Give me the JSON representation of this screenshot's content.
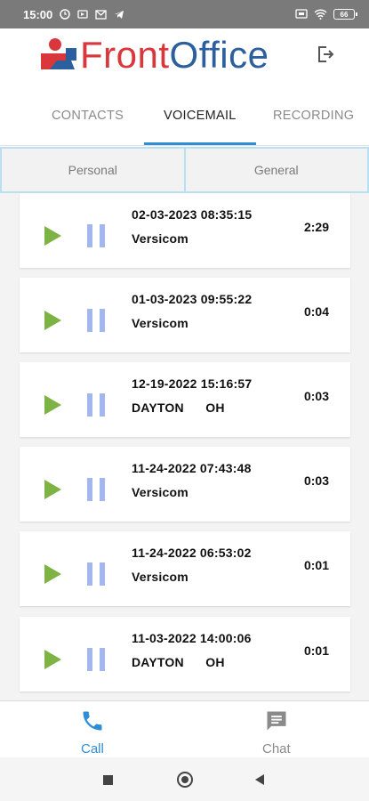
{
  "status_bar": {
    "time": "15:00",
    "battery": "66",
    "icons": [
      "alarm-icon",
      "media-icon",
      "mail-icon",
      "telegram-icon",
      "screen-icon",
      "wifi-icon",
      "battery-icon"
    ]
  },
  "header": {
    "logo_front": "Front",
    "logo_office": "Office",
    "logout_icon": "logout-icon"
  },
  "tabs": [
    {
      "label": "CONTACTS",
      "active": false
    },
    {
      "label": "VOICEMAIL",
      "active": true
    },
    {
      "label": "RECORDING",
      "active": false
    }
  ],
  "segments": [
    "Personal",
    "General"
  ],
  "voicemails": [
    {
      "date": "02-03-2023 08:35:15",
      "name": "Versicom",
      "duration": "2:29"
    },
    {
      "date": "01-03-2023 09:55:22",
      "name": "Versicom",
      "duration": "0:04"
    },
    {
      "date": "12-19-2022 15:16:57",
      "name": "DAYTON      OH",
      "duration": "0:03"
    },
    {
      "date": "11-24-2022 07:43:48",
      "name": "Versicom",
      "duration": "0:03"
    },
    {
      "date": "11-24-2022 06:53:02",
      "name": "Versicom",
      "duration": "0:01"
    },
    {
      "date": "11-03-2022 14:00:06",
      "name": "DAYTON      OH",
      "duration": "0:01"
    }
  ],
  "bottom_nav": [
    {
      "label": "Call",
      "icon": "phone-icon",
      "active": true
    },
    {
      "label": "Chat",
      "icon": "chat-icon",
      "active": false
    }
  ],
  "colors": {
    "accent": "#2f8fd6",
    "play": "#7cb342",
    "pause": "#a3b6ee",
    "brand_red": "#d9373b",
    "brand_blue": "#2b5f9e"
  }
}
